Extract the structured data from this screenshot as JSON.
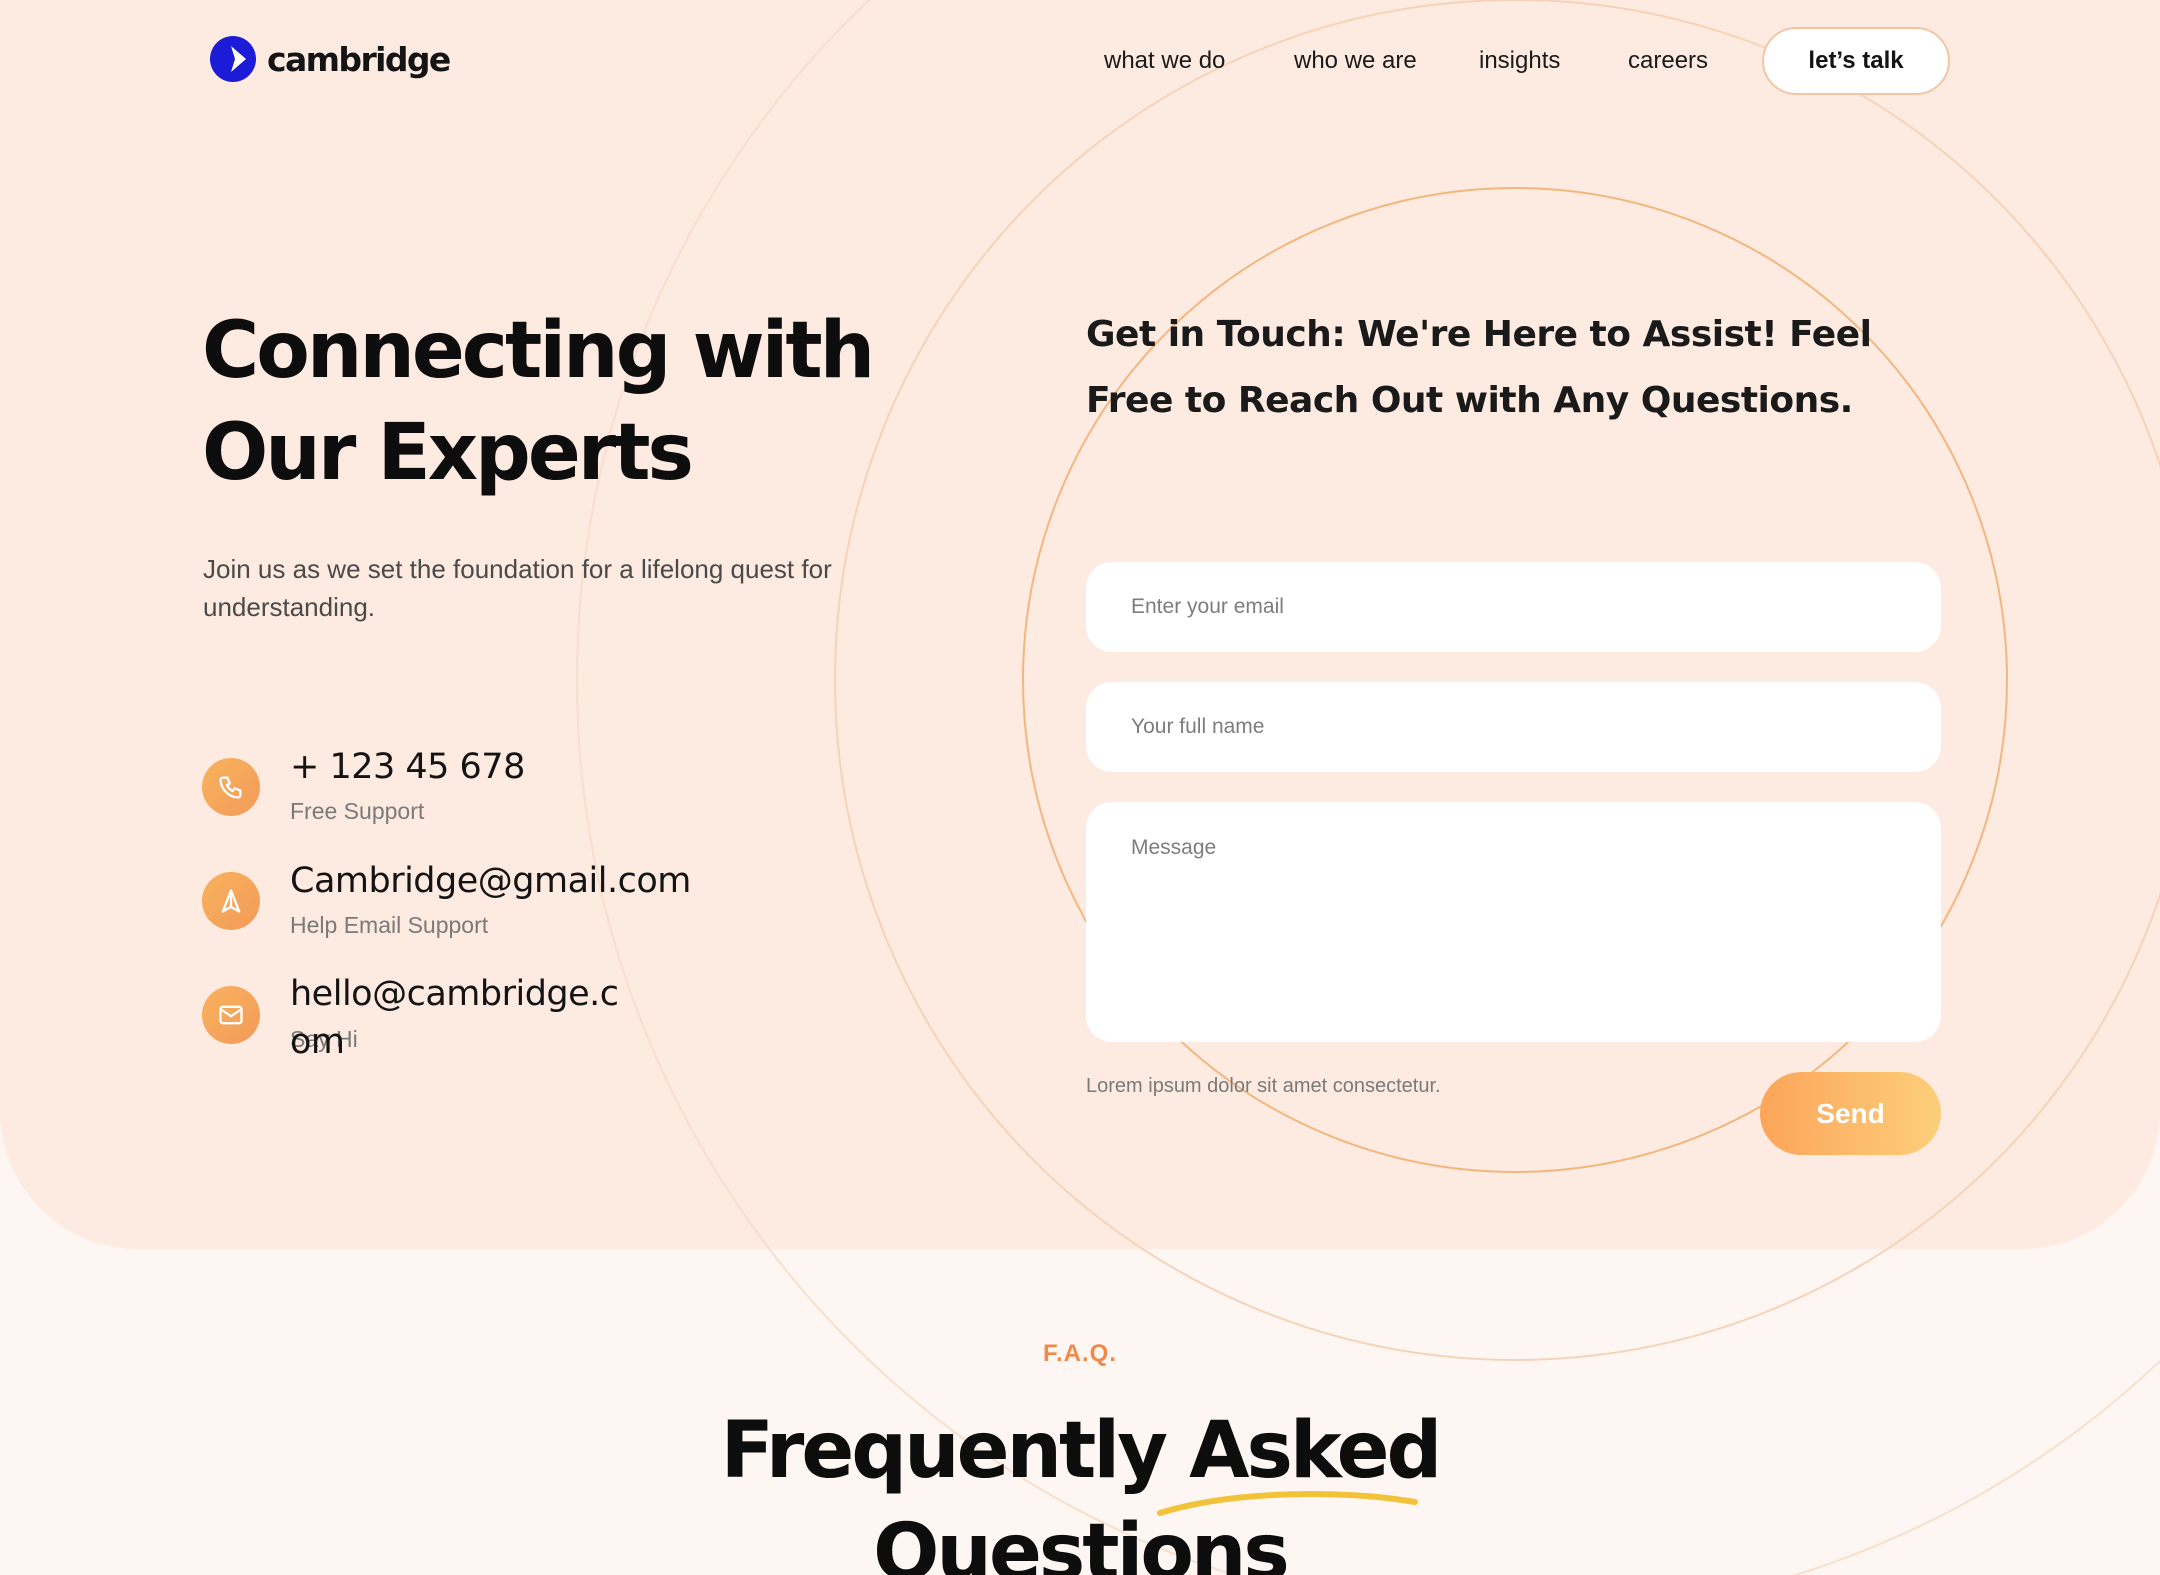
{
  "brand": {
    "name": "cambridge",
    "logo_color": "#1b1bd8"
  },
  "nav": {
    "items": [
      "what we do",
      "who we are",
      "insights",
      "careers"
    ],
    "cta_label": "let’s talk"
  },
  "hero": {
    "title_line1": "Connecting with",
    "title_line2": "Our Experts",
    "subtitle": "Join us as we set the foundation for a lifelong quest for understanding."
  },
  "contacts": [
    {
      "icon": "phone-icon",
      "value": "+ 123 45 678",
      "label": "Free Support"
    },
    {
      "icon": "navigation-icon",
      "value": "Cambridge@gmail.com",
      "label": "Help Email Support"
    },
    {
      "icon": "mail-icon",
      "value": "hello@cambridge.com",
      "label": "Say Hi"
    }
  ],
  "form": {
    "heading": "Get in Touch: We're Here to Assist! Feel Free to Reach Out with Any Questions.",
    "email_placeholder": "Enter your email",
    "name_placeholder": "Your full name",
    "message_placeholder": "Message",
    "note": "Lorem ipsum dolor sit amet consectetur.",
    "send_label": "Send"
  },
  "faq": {
    "tag": "F.A.Q.",
    "title_line1": "Frequently Asked",
    "title_line2": "Questions"
  },
  "colors": {
    "hero_bg": "#fdeae1",
    "page_bg": "#fdf6f2",
    "accent_orange": "#f8a95c",
    "faq_tag": "#ef8a4a",
    "underline_yellow": "#f2c33a"
  }
}
